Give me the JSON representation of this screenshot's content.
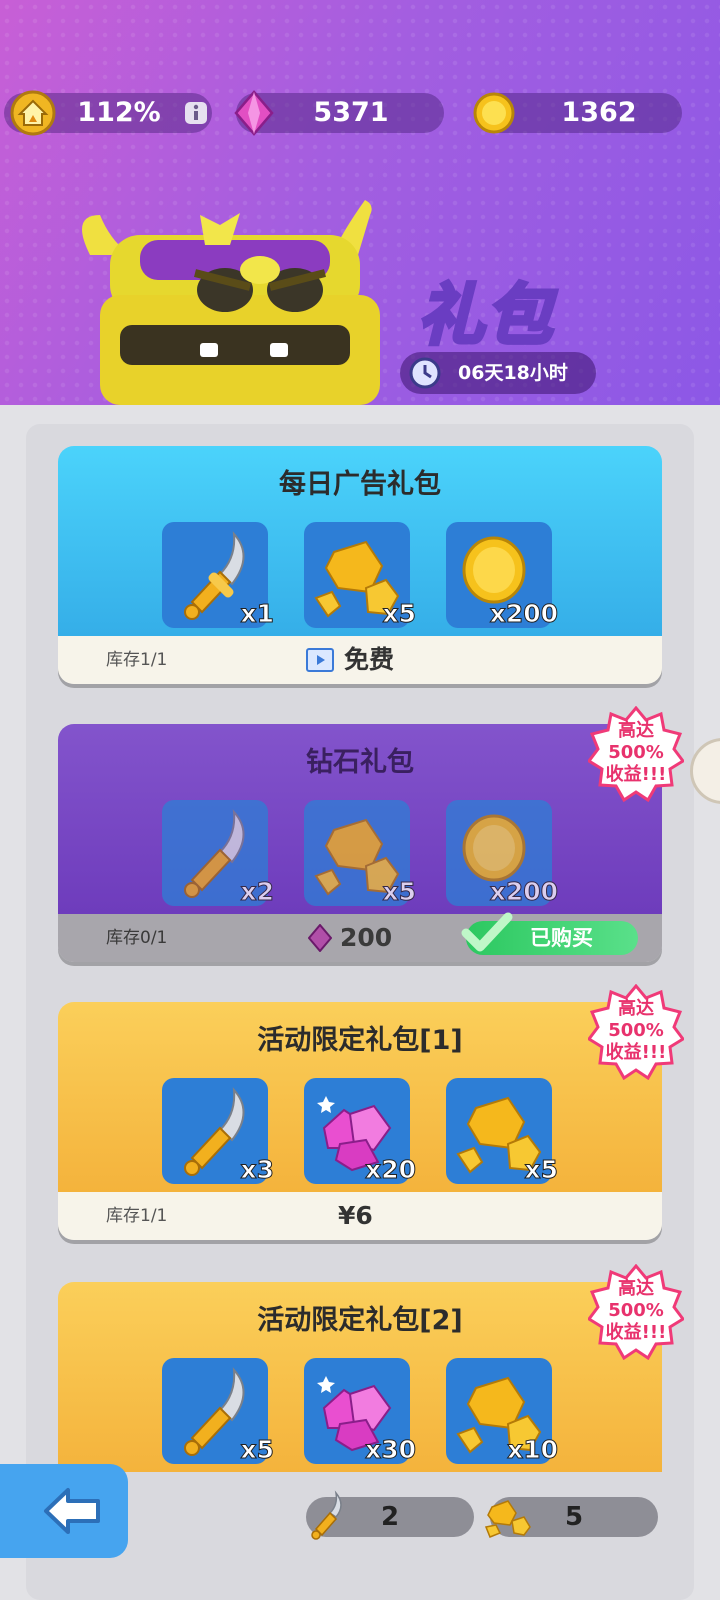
{
  "header": {
    "bonus_percent": "112%",
    "gems": "5371",
    "coins": "1362",
    "title": "礼包",
    "timer": "06天18小时"
  },
  "packs": [
    {
      "title": "每日广告礼包",
      "stock": "库存1/1",
      "price_label": "免费",
      "items": [
        {
          "icon": "sword-icon",
          "count": "x1"
        },
        {
          "icon": "gold-ore-icon",
          "count": "x5"
        },
        {
          "icon": "coin-icon",
          "count": "x200"
        }
      ]
    },
    {
      "title": "钻石礼包",
      "stock": "库存0/1",
      "price_label": "200",
      "purchased_label": "已购买",
      "badge": [
        "高达",
        "500%",
        "收益!!!"
      ],
      "items": [
        {
          "icon": "sword-icon",
          "count": "x2"
        },
        {
          "icon": "gold-ore-icon",
          "count": "x5"
        },
        {
          "icon": "coin-icon",
          "count": "x200"
        }
      ]
    },
    {
      "title": "活动限定礼包[1]",
      "stock": "库存1/1",
      "price_label": "¥6",
      "badge": [
        "高达",
        "500%",
        "收益!!!"
      ],
      "items": [
        {
          "icon": "sword-icon",
          "count": "x3"
        },
        {
          "icon": "gem-cluster-icon",
          "count": "x20"
        },
        {
          "icon": "gold-ore-icon",
          "count": "x5"
        }
      ]
    },
    {
      "title": "活动限定礼包[2]",
      "badge": [
        "高达",
        "500%",
        "收益!!!"
      ],
      "items": [
        {
          "icon": "sword-icon",
          "count": "x5"
        },
        {
          "icon": "gem-cluster-icon",
          "count": "x30"
        },
        {
          "icon": "gold-ore-icon",
          "count": "x10"
        }
      ]
    }
  ],
  "bottom": {
    "swords": "2",
    "gold_ore": "5"
  },
  "colors": {
    "header_purple": "#a35ee0",
    "card_blue": "#43c4f2",
    "card_purple": "#7b48c8",
    "card_orange": "#f6bd48",
    "badge_pink": "#f03a78",
    "purchased_green": "#3cd46c",
    "item_tile_blue": "#2d7ed6",
    "back_button_blue": "#46a4ef"
  }
}
